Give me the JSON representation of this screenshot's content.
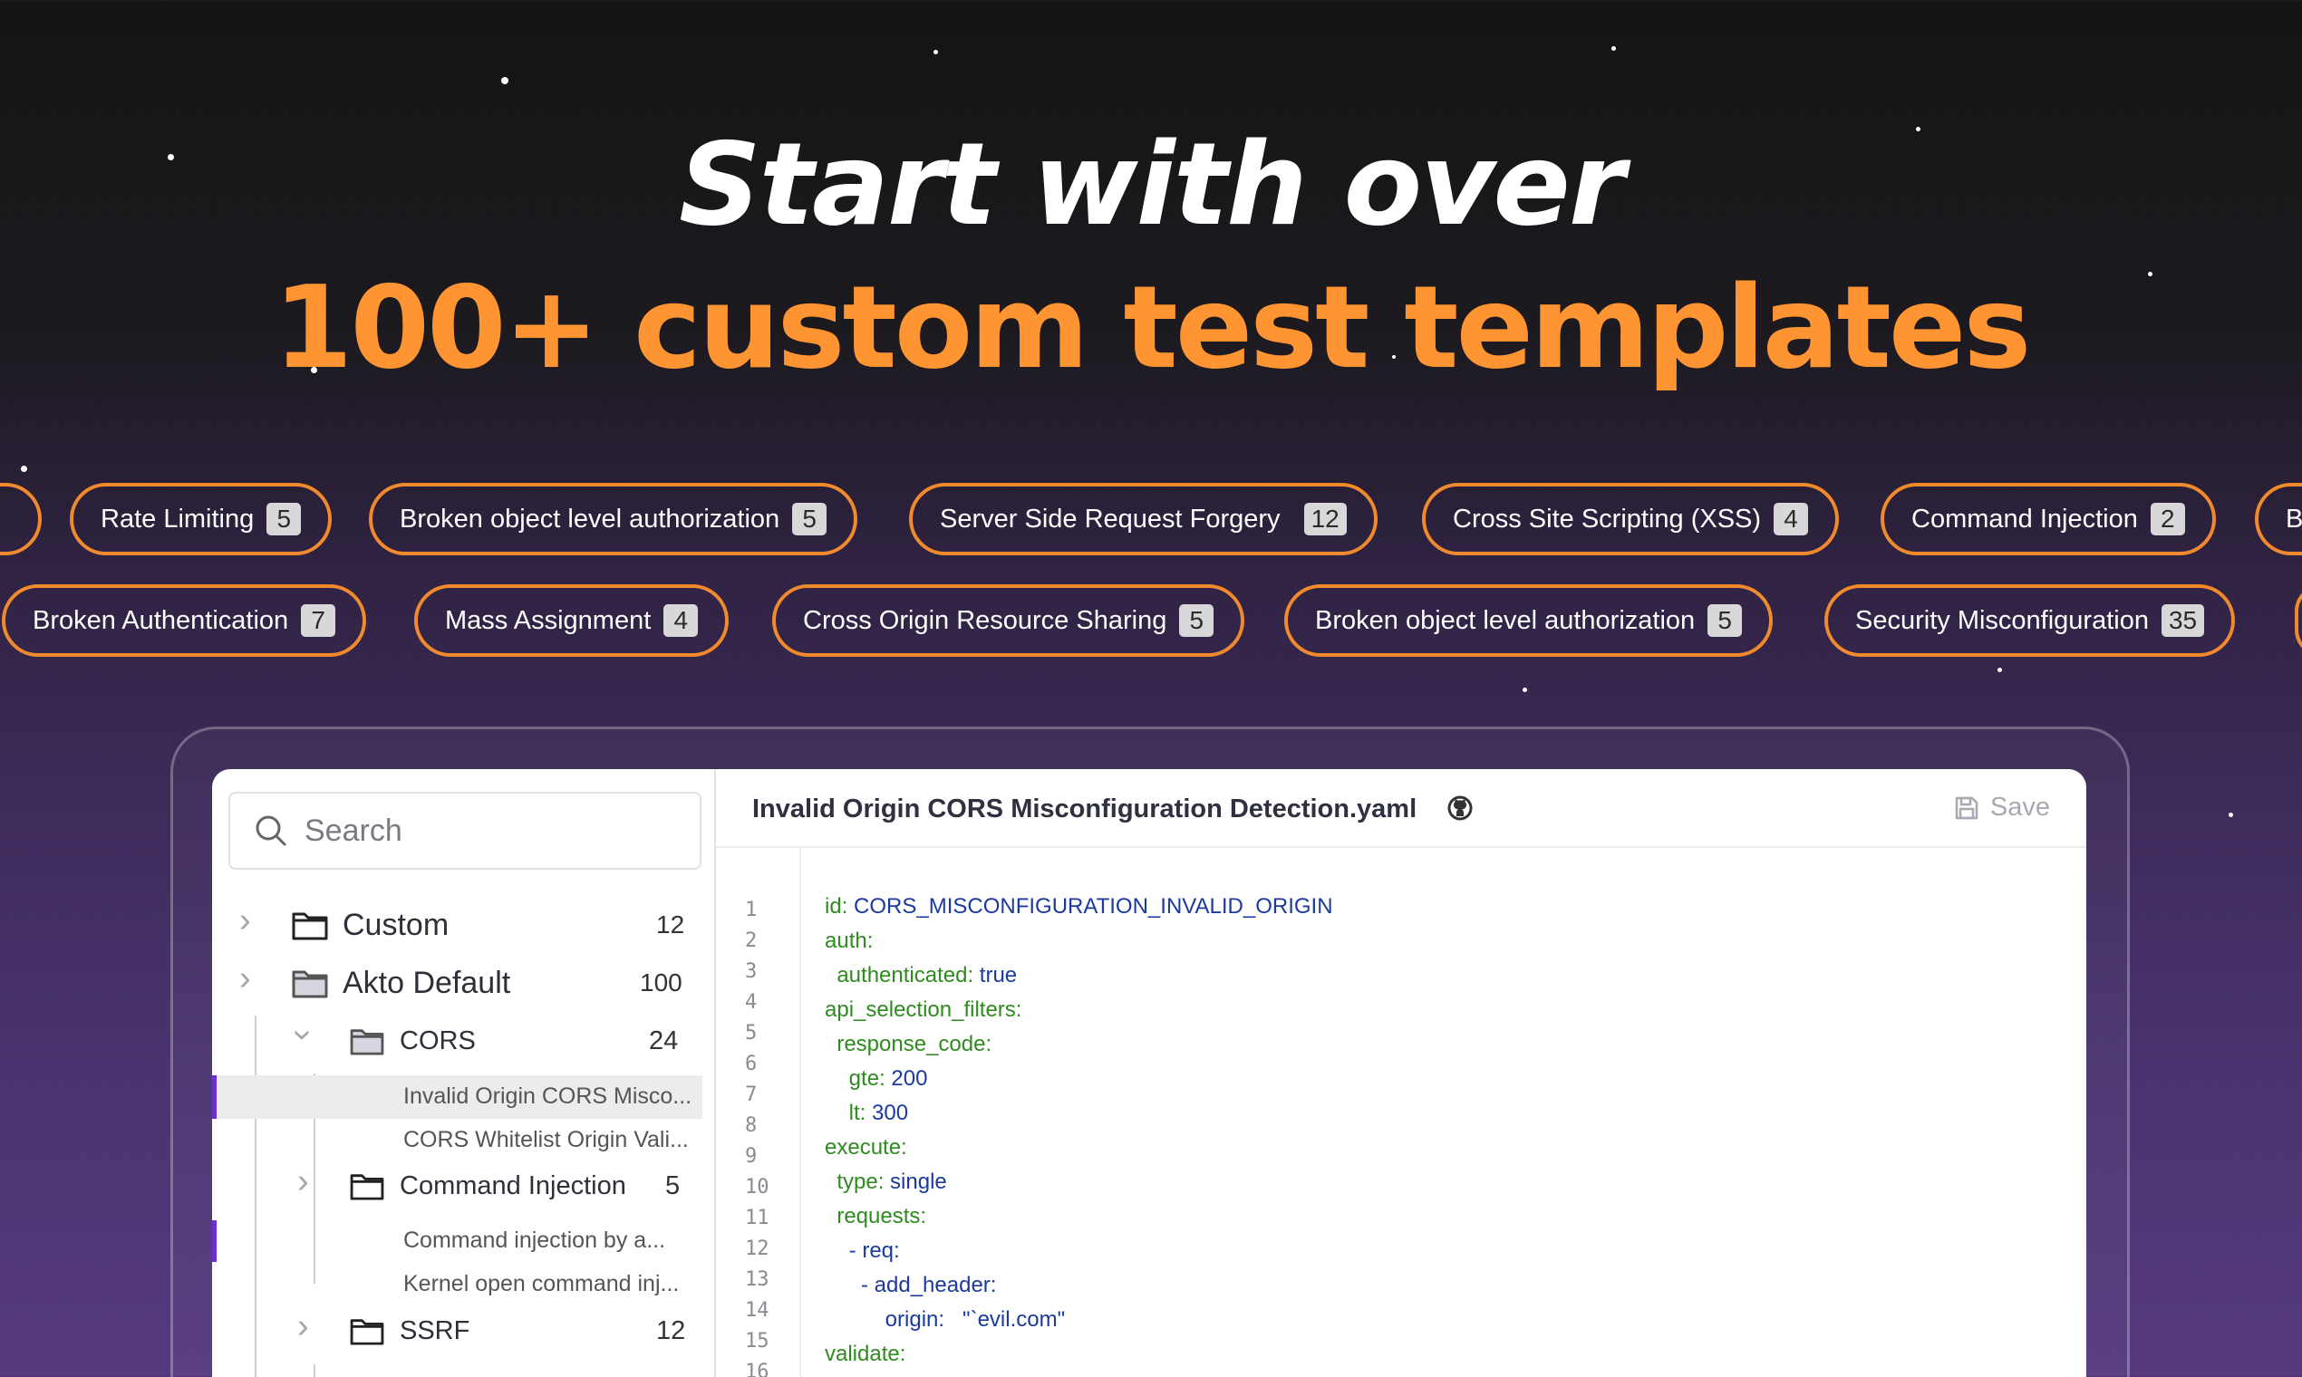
{
  "hero": {
    "line1": "Start with over",
    "line2": "100+ custom test templates"
  },
  "tags_row1": [
    {
      "label": "",
      "count": ""
    },
    {
      "label": "Rate Limiting",
      "count": "5"
    },
    {
      "label": "Broken object level authorization",
      "count": "5"
    },
    {
      "label": "Server Side Request Forgery",
      "count": "12"
    },
    {
      "label": "Cross Site Scripting (XSS)",
      "count": "4"
    },
    {
      "label": "Command Injection",
      "count": "2"
    },
    {
      "label": "B",
      "count": ""
    }
  ],
  "tags_row2": [
    {
      "label": "Broken Authentication",
      "count": "7"
    },
    {
      "label": "Mass Assignment",
      "count": "4"
    },
    {
      "label": "Cross Origin Resource Sharing",
      "count": "5"
    },
    {
      "label": "Broken object level authorization",
      "count": "5"
    },
    {
      "label": "Security Misconfiguration",
      "count": "35"
    }
  ],
  "sidebar": {
    "search_placeholder": "Search",
    "folders": [
      {
        "label": "Custom",
        "count": "12"
      },
      {
        "label": "Akto Default",
        "count": "100"
      },
      {
        "label": "CORS",
        "count": "24"
      },
      {
        "label": "Command Injection",
        "count": "5"
      },
      {
        "label": "SSRF",
        "count": "12"
      }
    ],
    "leaves": [
      "Invalid Origin CORS Misco...",
      "CORS Whitelist Origin Vali...",
      "Command injection by a...",
      "Kernel open command inj..."
    ]
  },
  "editor": {
    "file_name": "Invalid Origin CORS Misconfiguration Detection.yaml",
    "save_label": "Save",
    "line_numbers": [
      "1",
      "2",
      "3",
      "4",
      "5",
      "6",
      "7",
      "8",
      "9",
      "10",
      "11",
      "12",
      "13",
      "14",
      "15",
      "16"
    ],
    "lines": [
      {
        "k": "id:",
        "v": " CORS_MISCONFIGURATION_INVALID_ORIGIN"
      },
      {
        "k": "auth:",
        "v": ""
      },
      {
        "k": "  authenticated:",
        "v": " true"
      },
      {
        "k": "api_selection_filters:",
        "v": ""
      },
      {
        "k": "  response_code:",
        "v": ""
      },
      {
        "k": "    gte:",
        "v": " 200"
      },
      {
        "k": "    lt:",
        "v": " 300"
      },
      {
        "k": "execute:",
        "v": ""
      },
      {
        "k": "  type:",
        "v": " single"
      },
      {
        "k": "  requests:",
        "v": ""
      },
      {
        "k": "    - req:",
        "v": ""
      },
      {
        "k": "      - add_header:",
        "v": ""
      },
      {
        "k": "          origin:",
        "v": "   \"`evil.com\""
      },
      {
        "k": "validate:",
        "v": ""
      }
    ]
  },
  "colors": {
    "accent_orange": "#ff9432",
    "tag_border": "#f08a2c",
    "code_key": "#2e8b1e",
    "code_value": "#1b3a9e",
    "selection_bar": "#6b2fd6"
  }
}
